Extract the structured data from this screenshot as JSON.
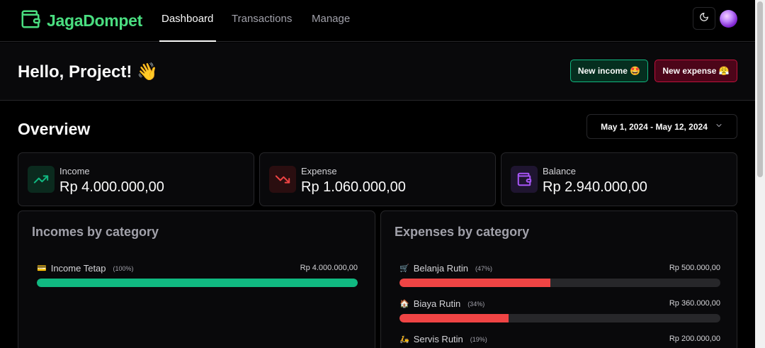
{
  "app": {
    "name": "JagaDompet"
  },
  "nav": {
    "dashboard": "Dashboard",
    "transactions": "Transactions",
    "manage": "Manage"
  },
  "header": {
    "greeting": "Hello, Project! 👋"
  },
  "actions": {
    "new_income": "New income 🤩",
    "new_expense": "New expense 😤"
  },
  "overview": {
    "title": "Overview",
    "date_range": "May 1, 2024 - May 12, 2024"
  },
  "stats": {
    "income": {
      "label": "Income",
      "value": "Rp 4.000.000,00"
    },
    "expense": {
      "label": "Expense",
      "value": "Rp 1.060.000,00"
    },
    "balance": {
      "label": "Balance",
      "value": "Rp 2.940.000,00"
    }
  },
  "incomes_by_category": {
    "title": "Incomes by category",
    "items": [
      {
        "emoji": "💳",
        "name": "Income Tetap",
        "percent": "(100%)",
        "amount": "Rp 4.000.000,00",
        "fraction": 1.0
      }
    ]
  },
  "expenses_by_category": {
    "title": "Expenses by category",
    "items": [
      {
        "emoji": "🛒",
        "name": "Belanja Rutin",
        "percent": "(47%)",
        "amount": "Rp 500.000,00",
        "fraction": 0.47
      },
      {
        "emoji": "🏠",
        "name": "Biaya Rutin",
        "percent": "(34%)",
        "amount": "Rp 360.000,00",
        "fraction": 0.34
      },
      {
        "emoji": "🛵",
        "name": "Servis Rutin",
        "percent": "(19%)",
        "amount": "Rp 200.000,00",
        "fraction": 0.19
      }
    ]
  },
  "colors": {
    "accent_green": "#4ade80",
    "income_bar": "#10b981",
    "expense_bar": "#ef4444",
    "balance_icon": "#a855f7"
  },
  "icons": {
    "logo": "wallet-icon",
    "theme": "moon-icon",
    "date": "chevron-down-icon",
    "income": "trending-up-icon",
    "expense": "trending-down-icon",
    "balance": "wallet-icon"
  }
}
